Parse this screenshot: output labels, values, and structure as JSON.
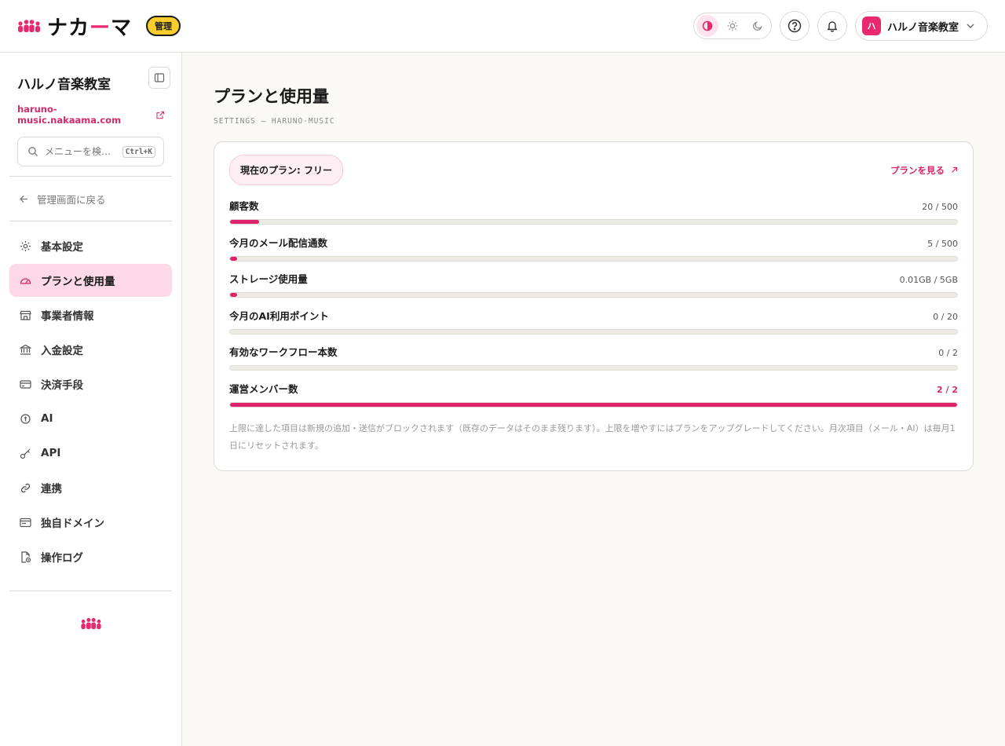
{
  "header": {
    "logo_text_main": "ナカ",
    "logo_text_dash": "ー",
    "logo_text_end": "マ",
    "admin_badge": "管理",
    "account_avatar": "ハ",
    "account_name": "ハルノ音楽教室"
  },
  "sidebar": {
    "school_name": "ハルノ音楽教室",
    "school_url": "haruno-music.nakaama.com",
    "search_placeholder": "メニューを検…",
    "search_shortcut": "Ctrl+K",
    "back_label": "管理画面に戻る",
    "items": [
      {
        "label": "基本設定",
        "icon": "gear-icon"
      },
      {
        "label": "プランと使用量",
        "icon": "gauge-icon",
        "active": true
      },
      {
        "label": "事業者情報",
        "icon": "store-icon"
      },
      {
        "label": "入金設定",
        "icon": "bank-icon"
      },
      {
        "label": "決済手段",
        "icon": "credit-card-icon"
      },
      {
        "label": "AI",
        "icon": "ai-icon"
      },
      {
        "label": "API",
        "icon": "key-icon"
      },
      {
        "label": "連携",
        "icon": "link-icon"
      },
      {
        "label": "独自ドメイン",
        "icon": "domain-icon"
      },
      {
        "label": "操作ログ",
        "icon": "log-icon"
      }
    ]
  },
  "main": {
    "title": "プランと使用量",
    "subtitle": "SETTINGS — HARUNO-MUSIC",
    "current_plan": "現在のプラン: フリー",
    "view_plans": "プランを見る",
    "usages": [
      {
        "label": "顧客数",
        "value": "20 / 500",
        "used": 20,
        "limit": 500
      },
      {
        "label": "今月のメール配信通数",
        "value": "5 / 500",
        "used": 5,
        "limit": 500
      },
      {
        "label": "ストレージ使用量",
        "value": "0.01GB / 5GB",
        "used": 0.01,
        "limit": 5
      },
      {
        "label": "今月のAI利用ポイント",
        "value": "0 / 20",
        "used": 0,
        "limit": 20
      },
      {
        "label": "有効なワークフロー本数",
        "value": "0 / 2",
        "used": 0,
        "limit": 2
      },
      {
        "label": "運営メンバー数",
        "value": "2 / 2",
        "used": 2,
        "limit": 2
      }
    ],
    "note": "上限に達した項目は新規の追加・送信がブロックされます（既存のデータはそのまま残ります）。上限を増やすにはプランをアップグレードしてください。月次項目（メール・AI）は毎月1日にリセットされます。"
  },
  "colors": {
    "accent": "#e0216b",
    "badge_yellow": "#f8cd2c",
    "active_bg": "#fdd9e7"
  }
}
